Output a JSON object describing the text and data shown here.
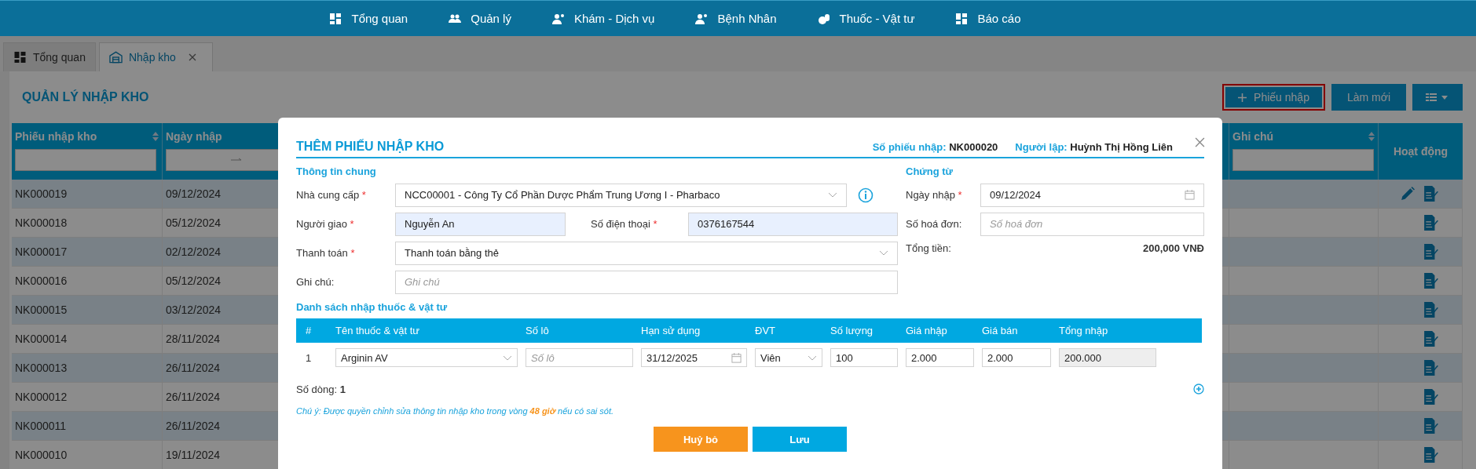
{
  "nav": [
    {
      "label": "Tổng quan"
    },
    {
      "label": "Quản lý"
    },
    {
      "label": "Khám - Dịch vụ"
    },
    {
      "label": "Bệnh Nhân"
    },
    {
      "label": "Thuốc - Vật tư"
    },
    {
      "label": "Báo cáo"
    }
  ],
  "tabs": [
    {
      "label": "Tổng quan",
      "selected": false,
      "closable": false
    },
    {
      "label": "Nhập kho",
      "selected": true,
      "closable": true
    }
  ],
  "page": {
    "title": "QUẢN LÝ NHẬP KHO",
    "buttons": [
      {
        "kind": "add",
        "label": "Phiếu nhập",
        "highlighted": true
      },
      {
        "kind": "refresh",
        "label": "Làm mới",
        "highlighted": false
      }
    ]
  },
  "table": {
    "columns": [
      {
        "label": "Phiếu nhập kho",
        "sortable": true,
        "kind": "text"
      },
      {
        "label": "Ngày nhập",
        "sortable": false,
        "kind": "daterange"
      },
      {
        "label": "Ghi chú",
        "sortable": true,
        "kind": "text"
      },
      {
        "label": "Hoạt động",
        "sortable": false,
        "kind": "actions"
      }
    ],
    "rows": [
      {
        "code": "NK000019",
        "date": "09/12/2024",
        "actions": [
          {
            "kind": "edit"
          },
          {
            "kind": "detail"
          }
        ]
      },
      {
        "code": "NK000018",
        "date": "05/12/2024",
        "actions": [
          {
            "kind": "detail"
          }
        ]
      },
      {
        "code": "NK000017",
        "date": "02/12/2024",
        "actions": [
          {
            "kind": "detail"
          }
        ]
      },
      {
        "code": "NK000016",
        "date": "05/12/2024",
        "actions": [
          {
            "kind": "detail"
          }
        ]
      },
      {
        "code": "NK000015",
        "date": "03/12/2024",
        "actions": [
          {
            "kind": "detail"
          }
        ]
      },
      {
        "code": "NK000014",
        "date": "28/11/2024",
        "actions": [
          {
            "kind": "detail"
          }
        ]
      },
      {
        "code": "NK000013",
        "date": "26/11/2024",
        "actions": [
          {
            "kind": "detail"
          }
        ]
      },
      {
        "code": "NK000012",
        "date": "26/11/2024",
        "actions": [
          {
            "kind": "detail"
          }
        ]
      },
      {
        "code": "NK000011",
        "date": "26/11/2024",
        "actions": [
          {
            "kind": "detail"
          }
        ]
      },
      {
        "code": "NK000010",
        "date": "19/11/2024",
        "actions": [
          {
            "kind": "detail"
          }
        ]
      }
    ]
  },
  "modal": {
    "title": "THÊM PHIẾU NHẬP KHO",
    "number_label": "Số phiếu nhập:",
    "number": "NK000020",
    "creator_label": "Người lập:",
    "creator": "Huỳnh Thị Hồng Liên",
    "general": {
      "heading": "Thông tin chung",
      "supplier": {
        "label": "Nhà cung cấp",
        "mark": "*",
        "value": "NCC00001 - Công Ty Cổ Phần Dược Phẩm Trung Ương I - Pharbaco"
      },
      "deliverer": {
        "label": "Người giao",
        "mark": "*",
        "value": "Nguyễn An"
      },
      "phone": {
        "label": "Số điện thoại",
        "mark": "*",
        "value": "0376167544"
      },
      "payment": {
        "label": "Thanh toán",
        "mark": "*",
        "value": "Thanh toán bằng thẻ"
      },
      "note": {
        "label": "Ghi chú:",
        "placeholder": "Ghi chú"
      }
    },
    "documents": {
      "heading": "Chứng từ",
      "date": {
        "label": "Ngày nhập",
        "mark": "*",
        "value": "09/12/2024"
      },
      "invoice": {
        "label": "Số hoá đơn:",
        "placeholder": "Số hoá đơn"
      },
      "total": {
        "label": "Tổng tiền:",
        "value": "200,000 VNĐ"
      }
    },
    "items": {
      "heading": "Danh sách nhập thuốc & vật tư",
      "columns": [
        "#",
        "Tên thuốc & vật tư",
        "Số lô",
        "Hạn sử dụng",
        "ĐVT",
        "Số lượng",
        "Giá nhập",
        "Giá bán",
        "Tổng nhập"
      ],
      "rows": [
        {
          "index": "1",
          "name": "Arginin AV",
          "lot_placeholder": "Số lô",
          "expiry": "31/12/2025",
          "unit": "Viên",
          "quantity": "100",
          "cost": "2.000",
          "price": "2.000",
          "total": "200.000"
        }
      ],
      "count_label": "Số dòng:",
      "count": "1"
    },
    "notice": "Chú ý: Được quyền chỉnh sửa thông tin nhập kho trong vòng **48 giờ** nếu có sai sót.",
    "buttons": [
      {
        "kind": "cancel",
        "label": "Huỷ bỏ"
      },
      {
        "kind": "save",
        "label": "Lưu"
      }
    ]
  }
}
